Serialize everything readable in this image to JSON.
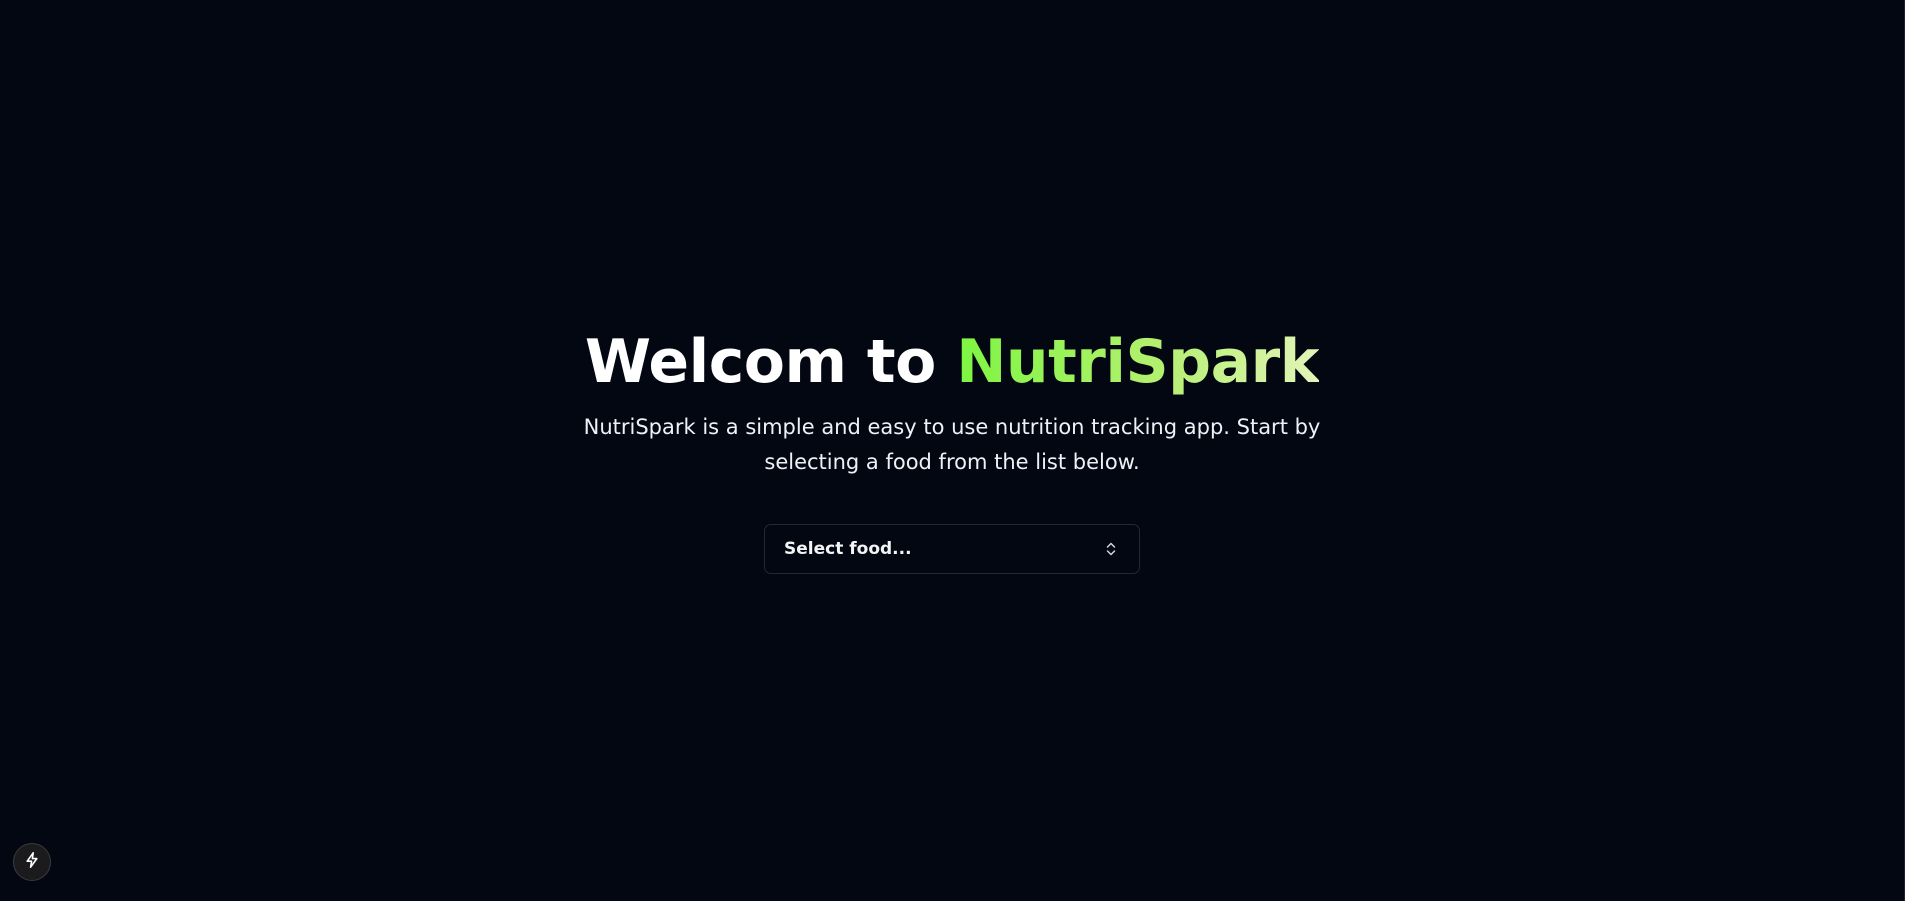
{
  "hero": {
    "title_prefix": "Welcom to ",
    "title_brand": "NutriSpark",
    "subtitle": "NutriSpark is a simple and easy to use nutrition tracking app. Start by selecting a food from the list below."
  },
  "food_select": {
    "placeholder": "Select food...",
    "icon": "chevrons-up-down-icon"
  },
  "dev_tools": {
    "icon": "lightning-bolt-icon"
  },
  "colors": {
    "background": "#030712",
    "brand_gradient_start": "#7ef542",
    "brand_gradient_end": "#e3f4b8",
    "text": "#ffffff"
  }
}
